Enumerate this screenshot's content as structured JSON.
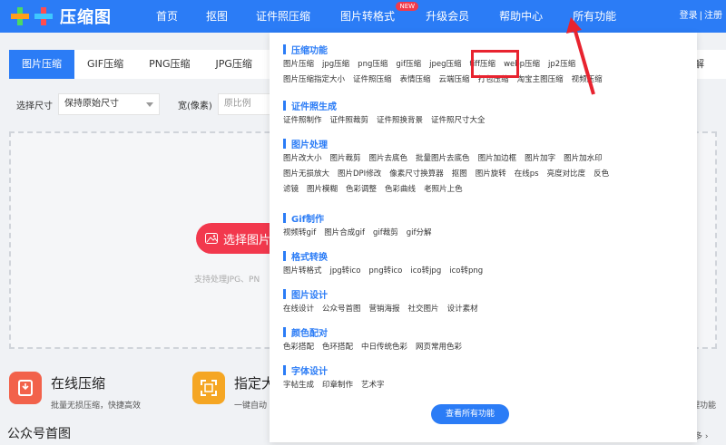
{
  "header": {
    "logo_text": "压缩图",
    "nav": [
      {
        "label": "首页"
      },
      {
        "label": "抠图"
      },
      {
        "label": "证件照压缩"
      },
      {
        "label": "图片转格式",
        "badge": "NEW"
      },
      {
        "label": "升级会员"
      },
      {
        "label": "帮助中心"
      },
      {
        "label": "所有功能"
      }
    ],
    "login": "登录",
    "separator": "|",
    "register": "注册"
  },
  "tabs": [
    "图片压缩",
    "GIF压缩",
    "PNG压缩",
    "JPG压缩",
    "图"
  ],
  "tab_right": "GIF分解",
  "options": {
    "size_label": "选择尺寸",
    "size_value": "保持原始尺寸",
    "width_label": "宽(像素)",
    "ratio_placeholder": "原比例"
  },
  "upload": {
    "button_label": "选择图片后",
    "support_text": "支持处理JPG、PN"
  },
  "features": [
    {
      "title": "在线压缩",
      "desc": "批量无损压缩，快捷高效"
    },
    {
      "title": "指定大",
      "desc": "一键自动"
    }
  ],
  "right_desc": "片处理功能",
  "public_title": "公众号首图",
  "more_label": "更多 ›",
  "dropdown": {
    "sections": [
      {
        "title": "压缩功能",
        "items": [
          "图片压缩",
          "jpg压缩",
          "png压缩",
          "gif压缩",
          "jpeg压缩",
          "tiff压缩",
          "webp压缩",
          "jp2压缩",
          "图片压缩指定大小",
          "证件照压缩",
          "表情压缩",
          "云端压缩",
          "打包压缩",
          "淘宝主图压缩",
          "视频压缩"
        ]
      },
      {
        "title": "证件照生成",
        "items": [
          "证件照制作",
          "证件照裁剪",
          "证件照换背景",
          "证件照尺寸大全"
        ]
      },
      {
        "title": "图片处理",
        "items": [
          "图片改大小",
          "图片裁剪",
          "图片去底色",
          "批量图片去底色",
          "图片加边框",
          "图片加字",
          "图片加水印",
          "图片无损放大",
          "图片DPI修改",
          "像素尺寸换算器",
          "抠图",
          "图片旋转",
          "在线ps",
          "亮度对比度",
          "反色",
          "滤镜",
          "图片模糊",
          "色彩调整",
          "色彩曲线",
          "老照片上色"
        ]
      },
      {
        "title": "Gif制作",
        "items": [
          "视频转gif",
          "图片合成gif",
          "gif裁剪",
          "gif分解"
        ]
      },
      {
        "title": "格式转换",
        "items": [
          "图片转格式",
          "jpg转ico",
          "png转ico",
          "ico转jpg",
          "ico转png"
        ]
      },
      {
        "title": "图片设计",
        "items": [
          "在线设计",
          "公众号首图",
          "营销海报",
          "社交图片",
          "设计素材"
        ]
      },
      {
        "title": "颜色配对",
        "items": [
          "色彩搭配",
          "色环搭配",
          "中日传统色彩",
          "网页常用色彩"
        ]
      },
      {
        "title": "字体设计",
        "items": [
          "字帖生成",
          "印章制作",
          "艺术字"
        ]
      }
    ],
    "view_all": "查看所有功能"
  },
  "colors": {
    "primary": "#2b7cf6",
    "accent_red": "#f2384d",
    "annotation_red": "#e8232f"
  }
}
